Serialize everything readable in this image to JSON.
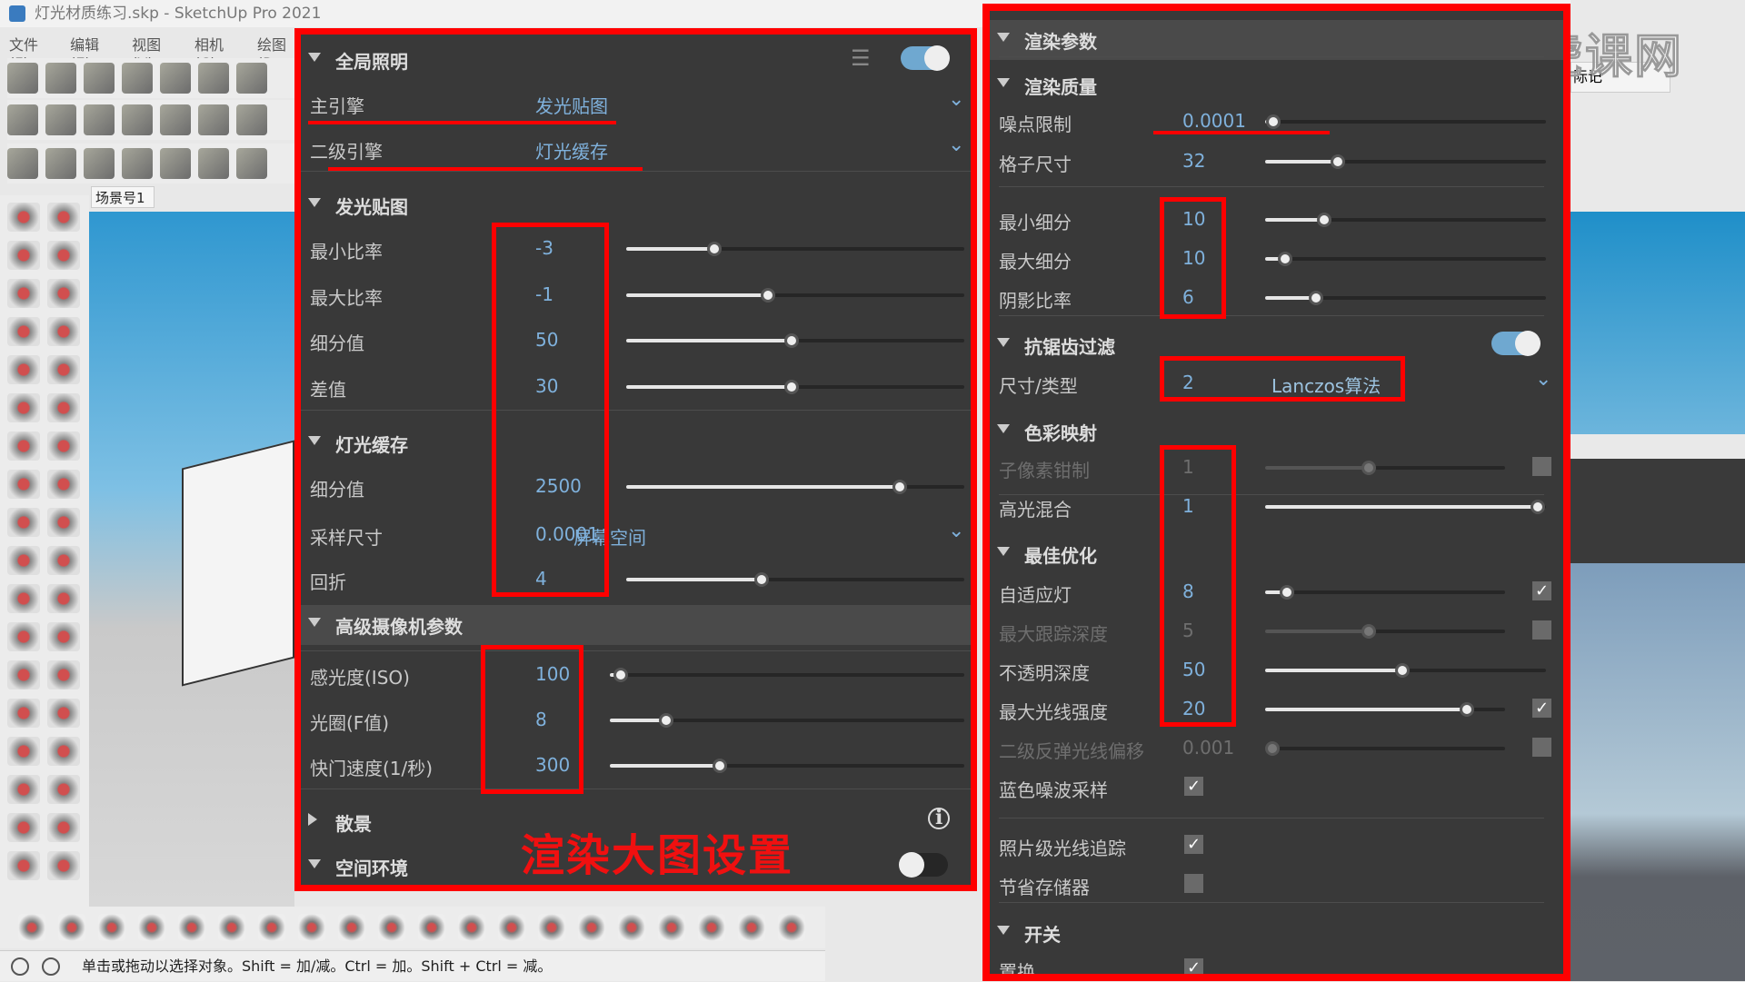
{
  "window": {
    "title": "灯光材质练习.skp - SketchUp Pro 2021"
  },
  "menu": [
    "文件(F)",
    "编辑(E)",
    "视图(V)",
    "相机(C)",
    "绘图(R"
  ],
  "scene_tab": "场景号1",
  "status": "单击或拖动以选择对象。Shift = 加/减。Ctrl = 加。Shift + Ctrl = 减。",
  "overlay_caption": "渲染大图设置",
  "side": {
    "mark_field": "际记",
    "watermark": "虎课网"
  },
  "colors": {
    "accent": "#7fb1dc",
    "highlight": "#ff0000",
    "panel_bg": "#393939"
  },
  "mid": {
    "rows": [
      {
        "type": "header",
        "label": "全局照明",
        "toggle": true,
        "toggle_on": true,
        "settings_icon": true
      },
      {
        "type": "select",
        "label": "主引擎",
        "value": "发光贴图"
      },
      {
        "type": "select",
        "label": "二级引擎",
        "value": "灯光缓存"
      },
      {
        "type": "header",
        "label": "发光贴图"
      },
      {
        "type": "slider",
        "label": "最小比率",
        "value": "-3",
        "level": 0.26
      },
      {
        "type": "slider",
        "label": "最大比率",
        "value": "-1",
        "level": 0.42
      },
      {
        "type": "slider",
        "label": "细分值",
        "value": "50",
        "level": 0.49
      },
      {
        "type": "slider",
        "label": "差值",
        "value": "30",
        "level": 0.49
      },
      {
        "type": "header",
        "label": "灯光缓存"
      },
      {
        "type": "slider",
        "label": "细分值",
        "value": "2500",
        "level": 0.81
      },
      {
        "type": "select2",
        "label": "采样尺寸",
        "value": "0.0001",
        "option": "屏幕空间"
      },
      {
        "type": "slider",
        "label": "回折",
        "value": "4",
        "level": 0.4
      },
      {
        "type": "header",
        "label": "高级摄像机参数",
        "shaded": true
      },
      {
        "type": "slider",
        "label": "感光度(ISO)",
        "value": "100",
        "level": 0.03
      },
      {
        "type": "slider",
        "label": "光圈(F值)",
        "value": "8",
        "level": 0.16
      },
      {
        "type": "slider",
        "label": "快门速度(1/秒)",
        "value": "300",
        "level": 0.31
      },
      {
        "type": "header",
        "label": "散景",
        "collapsed": true,
        "info_icon": true
      },
      {
        "type": "header",
        "label": "空间环境",
        "toggle": true,
        "toggle_on": false
      }
    ]
  },
  "right": {
    "rows": [
      {
        "type": "header",
        "label": "渲染参数",
        "shaded": true
      },
      {
        "type": "header",
        "label": "渲染质量"
      },
      {
        "type": "slider",
        "label": "噪点限制",
        "value": "0.0001",
        "level": 0.03
      },
      {
        "type": "slider",
        "label": "格子尺寸",
        "value": "32",
        "level": 0.26
      },
      {
        "type": "slider",
        "label": "最小细分",
        "value": "10",
        "level": 0.21
      },
      {
        "type": "slider",
        "label": "最大细分",
        "value": "10",
        "level": 0.07
      },
      {
        "type": "slider",
        "label": "阴影比率",
        "value": "6",
        "level": 0.18
      },
      {
        "type": "header",
        "label": "抗锯齿过滤",
        "toggle": true,
        "toggle_on": true
      },
      {
        "type": "select2",
        "label": "尺寸/类型",
        "value": "2",
        "option": "Lanczos算法"
      },
      {
        "type": "header",
        "label": "色彩映射"
      },
      {
        "type": "slider",
        "label": "子像素钳制",
        "value": "1",
        "level": 0.43,
        "disabled": true,
        "check": false
      },
      {
        "type": "slider",
        "label": "高光混合",
        "value": "1",
        "level": 0.97
      },
      {
        "type": "header",
        "label": "最佳优化"
      },
      {
        "type": "slider",
        "label": "自适应灯",
        "value": "8",
        "level": 0.09,
        "check": true
      },
      {
        "type": "slider",
        "label": "最大跟踪深度",
        "value": "5",
        "level": 0.43,
        "disabled": true,
        "check": false
      },
      {
        "type": "slider",
        "label": "不透明深度",
        "value": "50",
        "level": 0.49
      },
      {
        "type": "slider",
        "label": "最大光线强度",
        "value": "20",
        "level": 0.84,
        "check": true
      },
      {
        "type": "slider",
        "label": "二级反弹光线偏移",
        "value": "0.001",
        "level": 0.03,
        "disabled": true,
        "check": false
      },
      {
        "type": "check",
        "label": "蓝色噪波采样",
        "checked": true
      },
      {
        "type": "check",
        "label": "照片级光线追踪",
        "checked": true
      },
      {
        "type": "check",
        "label": "节省存储器",
        "checked": false
      },
      {
        "type": "header",
        "label": "开关"
      },
      {
        "type": "check",
        "label": "置换",
        "checked": true
      }
    ]
  }
}
